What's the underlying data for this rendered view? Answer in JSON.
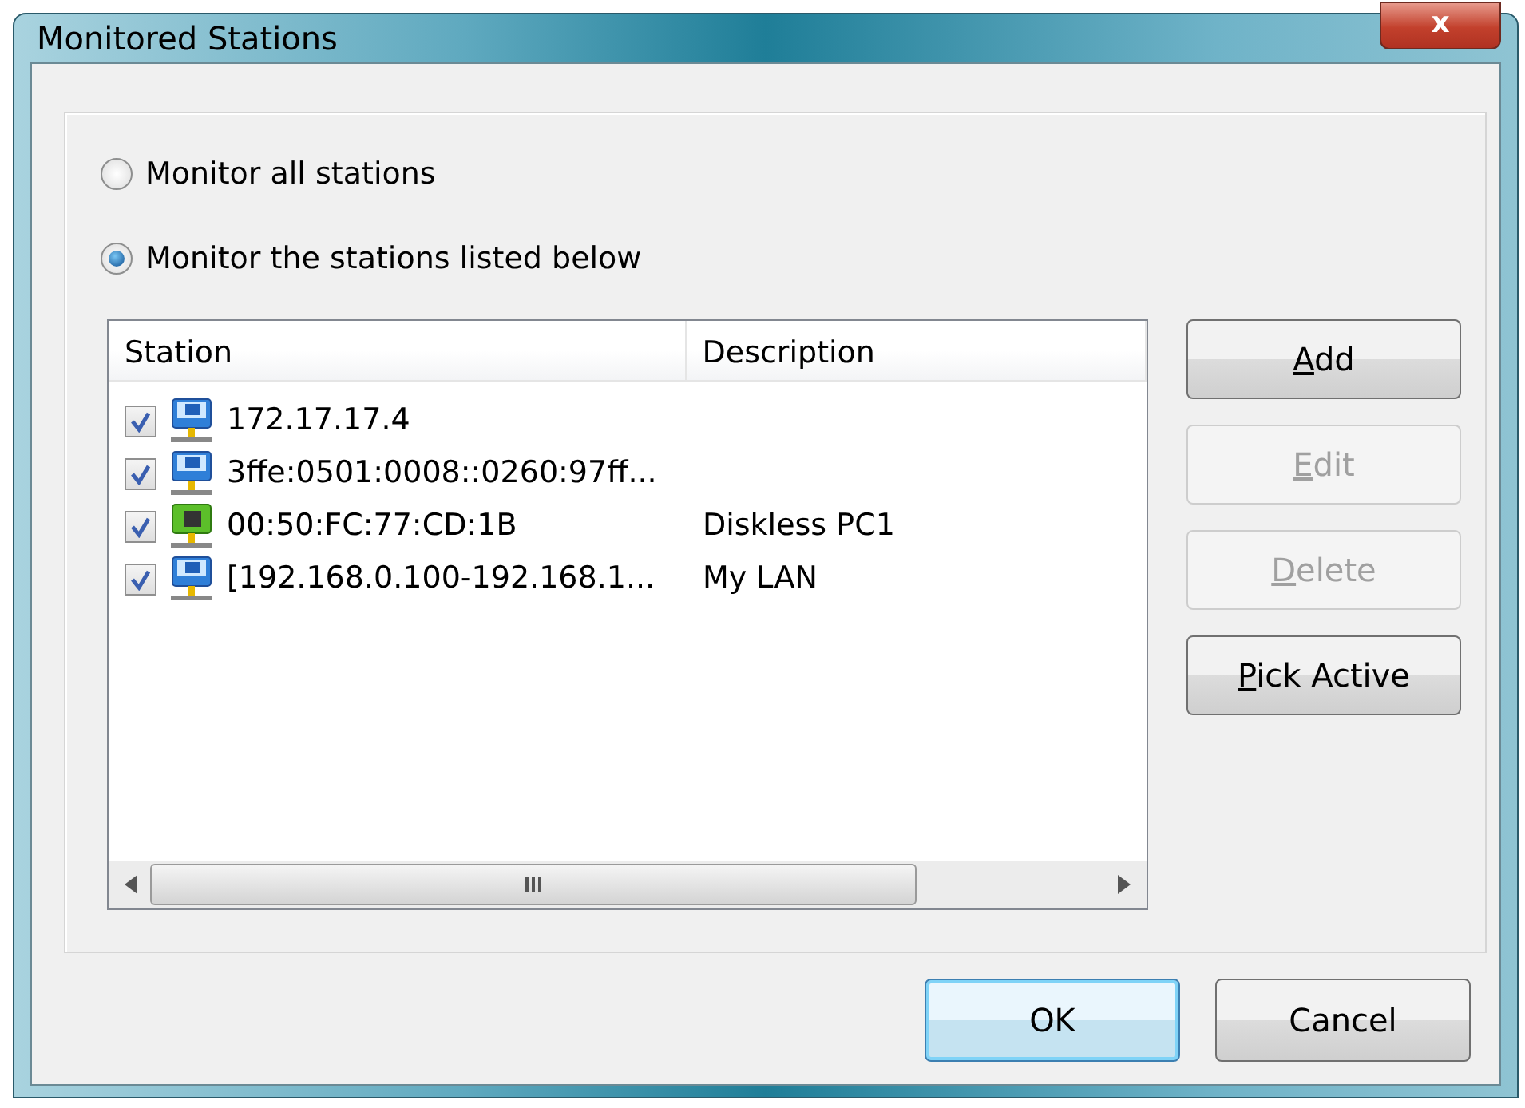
{
  "window": {
    "title": "Monitored Stations",
    "close_label": "x"
  },
  "mode_options": [
    {
      "label": "Monitor all stations",
      "selected": false
    },
    {
      "label": "Monitor the stations listed below",
      "selected": true
    }
  ],
  "table": {
    "columns": [
      "Station",
      "Description"
    ],
    "rows": [
      {
        "kind": "ip",
        "checked": true,
        "station": "172.17.17.4",
        "description": ""
      },
      {
        "kind": "ip",
        "checked": true,
        "station": "3ffe:0501:0008::0260:97ff...",
        "description": ""
      },
      {
        "kind": "mac",
        "checked": true,
        "station": "00:50:FC:77:CD:1B",
        "description": "Diskless PC1"
      },
      {
        "kind": "ip",
        "checked": true,
        "station": "[192.168.0.100-192.168.1...",
        "description": "My LAN"
      }
    ]
  },
  "side_buttons": [
    {
      "mnemonic": "A",
      "rest": "dd",
      "disabled": false
    },
    {
      "mnemonic": "E",
      "rest": "dit",
      "disabled": true
    },
    {
      "mnemonic": "D",
      "rest": "elete",
      "disabled": true
    },
    {
      "mnemonic": "P",
      "rest": "ick Active",
      "disabled": false
    }
  ],
  "footer_buttons": [
    {
      "label": "OK",
      "default": true
    },
    {
      "label": "Cancel",
      "default": false
    }
  ]
}
